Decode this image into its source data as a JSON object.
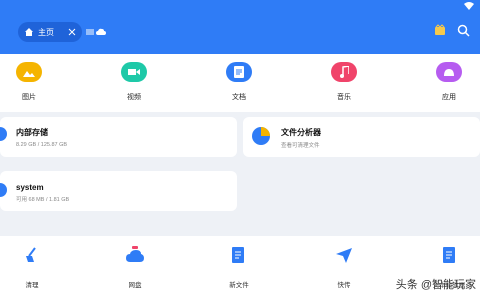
{
  "header": {
    "tab_label": "主页",
    "accent": "#2f7cf6",
    "icons": [
      "wifi-icon",
      "home-icon",
      "close-icon",
      "menu-icon",
      "cloud-icon",
      "vip-icon",
      "search-icon"
    ]
  },
  "categories": [
    {
      "label": "图片",
      "icon": "image-icon",
      "color": "#f5b400"
    },
    {
      "label": "视频",
      "icon": "video-icon",
      "color": "#1ec9a8"
    },
    {
      "label": "文档",
      "icon": "document-icon",
      "color": "#2f7cf6"
    },
    {
      "label": "音乐",
      "icon": "music-icon",
      "color": "#f0446a"
    },
    {
      "label": "应用",
      "icon": "android-icon",
      "color": "#b65cf0"
    }
  ],
  "storage": {
    "internal": {
      "title": "内部存储",
      "detail": "8.29 GB / 125.87 GB"
    },
    "file_analyzer": {
      "title": "文件分析器",
      "detail": "查看可清理文件"
    },
    "system": {
      "title": "system",
      "detail": "可用 68 MB / 1.81 GB"
    }
  },
  "tools": [
    {
      "label": "清理",
      "icon": "broom-icon"
    },
    {
      "label": "网盘",
      "icon": "cloud-drive-icon"
    },
    {
      "label": "新文件",
      "icon": "new-file-icon"
    },
    {
      "label": "快传",
      "icon": "send-icon"
    },
    {
      "label": "文本编辑器",
      "icon": "text-editor-icon"
    }
  ],
  "watermark": "头条 @智能玩家"
}
